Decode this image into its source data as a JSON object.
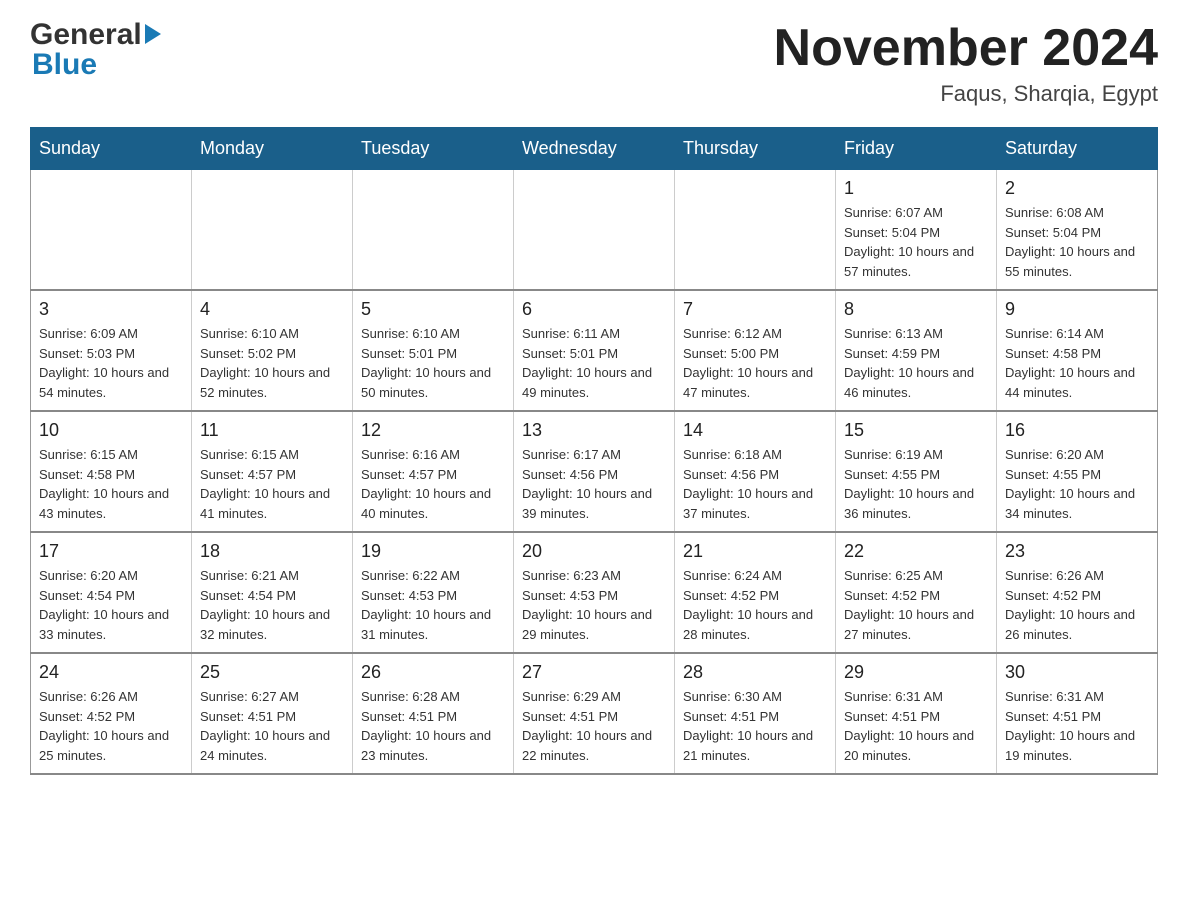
{
  "header": {
    "logo_text1": "General",
    "logo_text2": "Blue",
    "title": "November 2024",
    "subtitle": "Faqus, Sharqia, Egypt"
  },
  "days_of_week": [
    "Sunday",
    "Monday",
    "Tuesday",
    "Wednesday",
    "Thursday",
    "Friday",
    "Saturday"
  ],
  "weeks": [
    [
      {
        "day": "",
        "info": ""
      },
      {
        "day": "",
        "info": ""
      },
      {
        "day": "",
        "info": ""
      },
      {
        "day": "",
        "info": ""
      },
      {
        "day": "",
        "info": ""
      },
      {
        "day": "1",
        "info": "Sunrise: 6:07 AM\nSunset: 5:04 PM\nDaylight: 10 hours and 57 minutes."
      },
      {
        "day": "2",
        "info": "Sunrise: 6:08 AM\nSunset: 5:04 PM\nDaylight: 10 hours and 55 minutes."
      }
    ],
    [
      {
        "day": "3",
        "info": "Sunrise: 6:09 AM\nSunset: 5:03 PM\nDaylight: 10 hours and 54 minutes."
      },
      {
        "day": "4",
        "info": "Sunrise: 6:10 AM\nSunset: 5:02 PM\nDaylight: 10 hours and 52 minutes."
      },
      {
        "day": "5",
        "info": "Sunrise: 6:10 AM\nSunset: 5:01 PM\nDaylight: 10 hours and 50 minutes."
      },
      {
        "day": "6",
        "info": "Sunrise: 6:11 AM\nSunset: 5:01 PM\nDaylight: 10 hours and 49 minutes."
      },
      {
        "day": "7",
        "info": "Sunrise: 6:12 AM\nSunset: 5:00 PM\nDaylight: 10 hours and 47 minutes."
      },
      {
        "day": "8",
        "info": "Sunrise: 6:13 AM\nSunset: 4:59 PM\nDaylight: 10 hours and 46 minutes."
      },
      {
        "day": "9",
        "info": "Sunrise: 6:14 AM\nSunset: 4:58 PM\nDaylight: 10 hours and 44 minutes."
      }
    ],
    [
      {
        "day": "10",
        "info": "Sunrise: 6:15 AM\nSunset: 4:58 PM\nDaylight: 10 hours and 43 minutes."
      },
      {
        "day": "11",
        "info": "Sunrise: 6:15 AM\nSunset: 4:57 PM\nDaylight: 10 hours and 41 minutes."
      },
      {
        "day": "12",
        "info": "Sunrise: 6:16 AM\nSunset: 4:57 PM\nDaylight: 10 hours and 40 minutes."
      },
      {
        "day": "13",
        "info": "Sunrise: 6:17 AM\nSunset: 4:56 PM\nDaylight: 10 hours and 39 minutes."
      },
      {
        "day": "14",
        "info": "Sunrise: 6:18 AM\nSunset: 4:56 PM\nDaylight: 10 hours and 37 minutes."
      },
      {
        "day": "15",
        "info": "Sunrise: 6:19 AM\nSunset: 4:55 PM\nDaylight: 10 hours and 36 minutes."
      },
      {
        "day": "16",
        "info": "Sunrise: 6:20 AM\nSunset: 4:55 PM\nDaylight: 10 hours and 34 minutes."
      }
    ],
    [
      {
        "day": "17",
        "info": "Sunrise: 6:20 AM\nSunset: 4:54 PM\nDaylight: 10 hours and 33 minutes."
      },
      {
        "day": "18",
        "info": "Sunrise: 6:21 AM\nSunset: 4:54 PM\nDaylight: 10 hours and 32 minutes."
      },
      {
        "day": "19",
        "info": "Sunrise: 6:22 AM\nSunset: 4:53 PM\nDaylight: 10 hours and 31 minutes."
      },
      {
        "day": "20",
        "info": "Sunrise: 6:23 AM\nSunset: 4:53 PM\nDaylight: 10 hours and 29 minutes."
      },
      {
        "day": "21",
        "info": "Sunrise: 6:24 AM\nSunset: 4:52 PM\nDaylight: 10 hours and 28 minutes."
      },
      {
        "day": "22",
        "info": "Sunrise: 6:25 AM\nSunset: 4:52 PM\nDaylight: 10 hours and 27 minutes."
      },
      {
        "day": "23",
        "info": "Sunrise: 6:26 AM\nSunset: 4:52 PM\nDaylight: 10 hours and 26 minutes."
      }
    ],
    [
      {
        "day": "24",
        "info": "Sunrise: 6:26 AM\nSunset: 4:52 PM\nDaylight: 10 hours and 25 minutes."
      },
      {
        "day": "25",
        "info": "Sunrise: 6:27 AM\nSunset: 4:51 PM\nDaylight: 10 hours and 24 minutes."
      },
      {
        "day": "26",
        "info": "Sunrise: 6:28 AM\nSunset: 4:51 PM\nDaylight: 10 hours and 23 minutes."
      },
      {
        "day": "27",
        "info": "Sunrise: 6:29 AM\nSunset: 4:51 PM\nDaylight: 10 hours and 22 minutes."
      },
      {
        "day": "28",
        "info": "Sunrise: 6:30 AM\nSunset: 4:51 PM\nDaylight: 10 hours and 21 minutes."
      },
      {
        "day": "29",
        "info": "Sunrise: 6:31 AM\nSunset: 4:51 PM\nDaylight: 10 hours and 20 minutes."
      },
      {
        "day": "30",
        "info": "Sunrise: 6:31 AM\nSunset: 4:51 PM\nDaylight: 10 hours and 19 minutes."
      }
    ]
  ]
}
